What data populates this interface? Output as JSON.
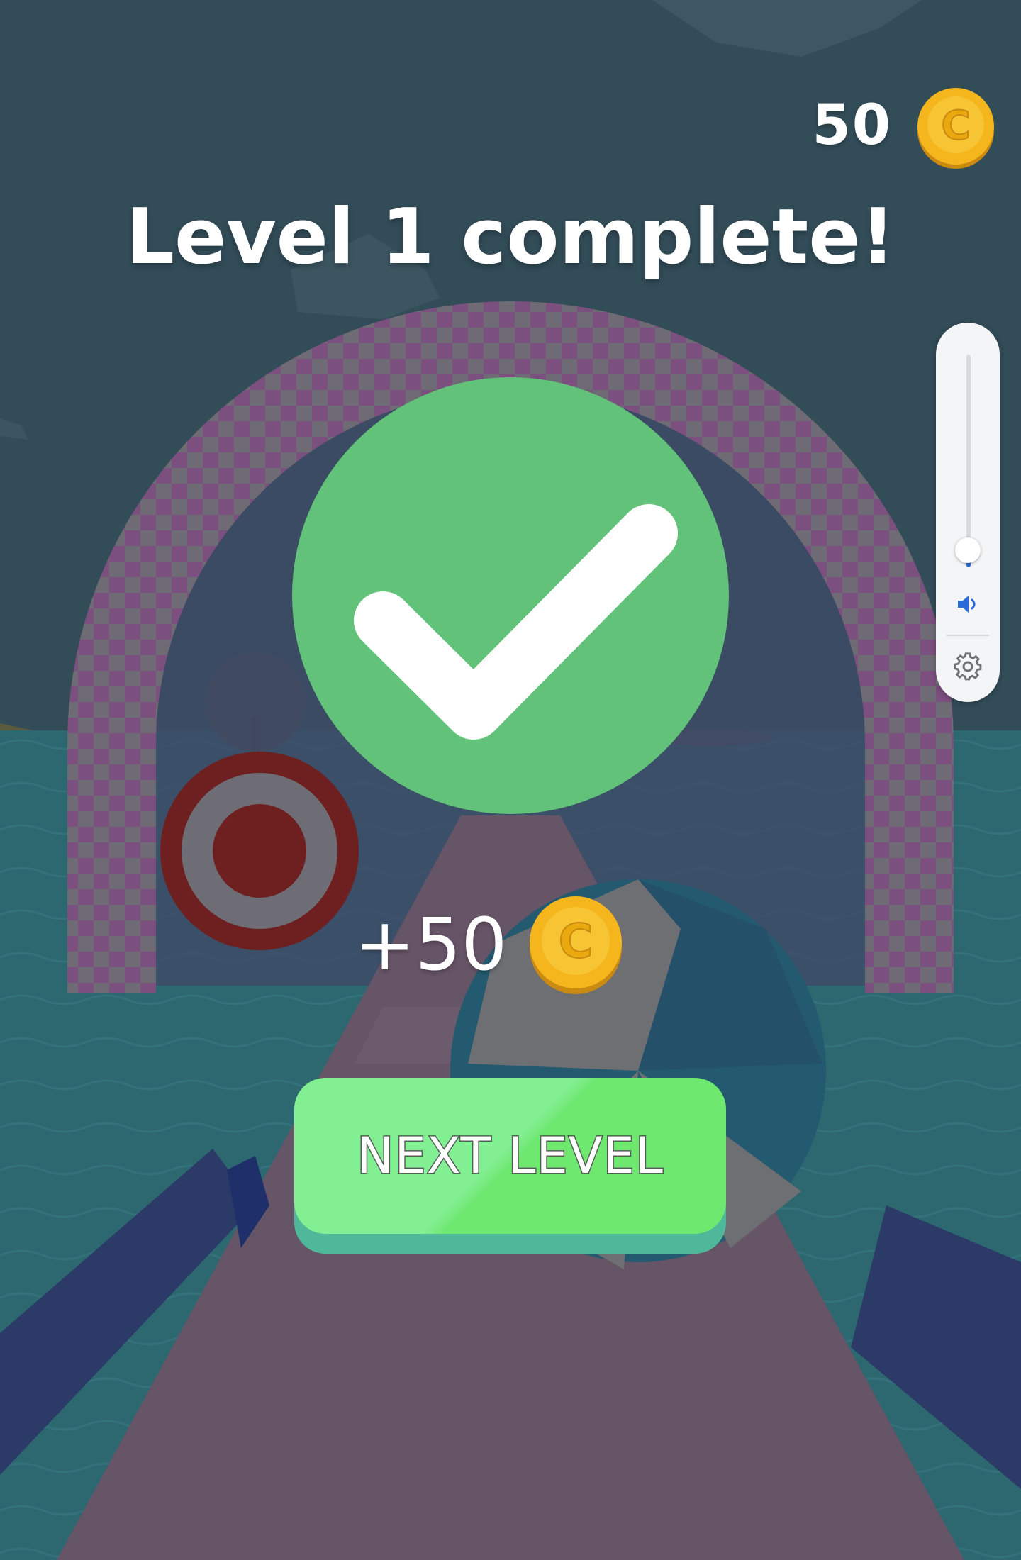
{
  "hud": {
    "coins": "50"
  },
  "title": "Level 1 complete!",
  "reward": {
    "amount": "+50"
  },
  "next_button": {
    "label": "NEXT LEVEL"
  },
  "colors": {
    "check_circle": "#62c27a",
    "button_face": "#82ef93",
    "button_shadow": "#4fb89a",
    "coin_gold": "#f4b51d",
    "volume_accent": "#2a6ad9"
  },
  "volume": {
    "level": 0.07
  },
  "icons": [
    "coin-icon",
    "checkmark-icon",
    "speaker-icon",
    "gear-icon"
  ]
}
